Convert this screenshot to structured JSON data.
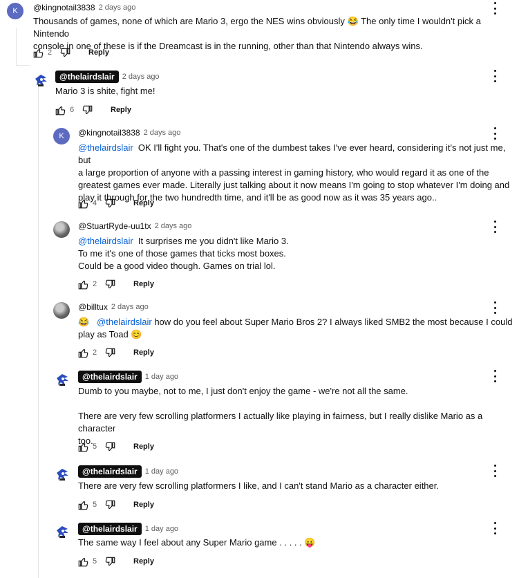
{
  "comments": [
    {
      "avatar_letter": "K",
      "author": "@kingnotail3838",
      "time": "2 days ago",
      "lines": [
        "Thousands of games, none of which are Mario 3, ergo the NES wins obviously 😂 The only time I wouldn't pick a Nintendo",
        "console in one of these is if the Dreamcast is in the running, other than that Nintendo always wins."
      ],
      "likes": "2",
      "reply": "Reply"
    },
    {
      "author": "@thelairdslair",
      "time": "2 days ago",
      "lines": [
        "Mario 3 is shite, fight me!"
      ],
      "likes": "6",
      "reply": "Reply"
    },
    {
      "avatar_letter": "K",
      "author": "@kingnotail3838",
      "time": "2 days ago",
      "mention": "@thelairdslair",
      "lines": [
        "OK I'll fight you. That's one of the dumbest takes I've ever heard, considering it's not just me, but",
        "a large proportion of anyone with a passing interest in gaming history, who would regard it as one of the",
        "greatest games ever made. Literally just talking about it now means I'm going to stop whatever I'm doing and",
        "play it through for the two hundredth time, and it'll be as good now as it was 35 years ago.."
      ],
      "likes": "4",
      "reply": "Reply"
    },
    {
      "author": "@StuartRyde-uu1tx",
      "time": "2 days ago",
      "mention": "@thelairdslair",
      "lines": [
        "It surprises me you didn't like Mario 3.",
        "To me it's one of those games that ticks most boxes.",
        "Could be a good video though. Games on trial lol."
      ],
      "likes": "2",
      "reply": "Reply"
    },
    {
      "author": "@billtux",
      "time": "2 days ago",
      "mention": "@thelairdslair",
      "lines": [
        "😂",
        "how do you feel about Super Mario Bros 2? I always liked SMB2 the most because I could",
        "play as Toad 😊"
      ],
      "likes": "2",
      "reply": "Reply"
    },
    {
      "author": "@thelairdslair",
      "time": "1 day ago",
      "lines": [
        "Dumb to you maybe, not to me, I just don't enjoy the game - we're not all the same.",
        "",
        "There are very few scrolling platformers I actually like playing in fairness, but I really dislike Mario as a character",
        "too."
      ],
      "likes": "5",
      "reply": "Reply"
    },
    {
      "author": "@thelairdslair",
      "time": "1 day ago",
      "lines": [
        "There are very few scrolling platformers I like, and I can't stand Mario as a character either."
      ],
      "likes": "5",
      "reply": "Reply"
    },
    {
      "author": "@thelairdslair",
      "time": "1 day ago",
      "lines": [
        "The same way I feel about any Super Mario game . . . . . 😛"
      ],
      "likes": "5",
      "reply": "Reply"
    }
  ]
}
